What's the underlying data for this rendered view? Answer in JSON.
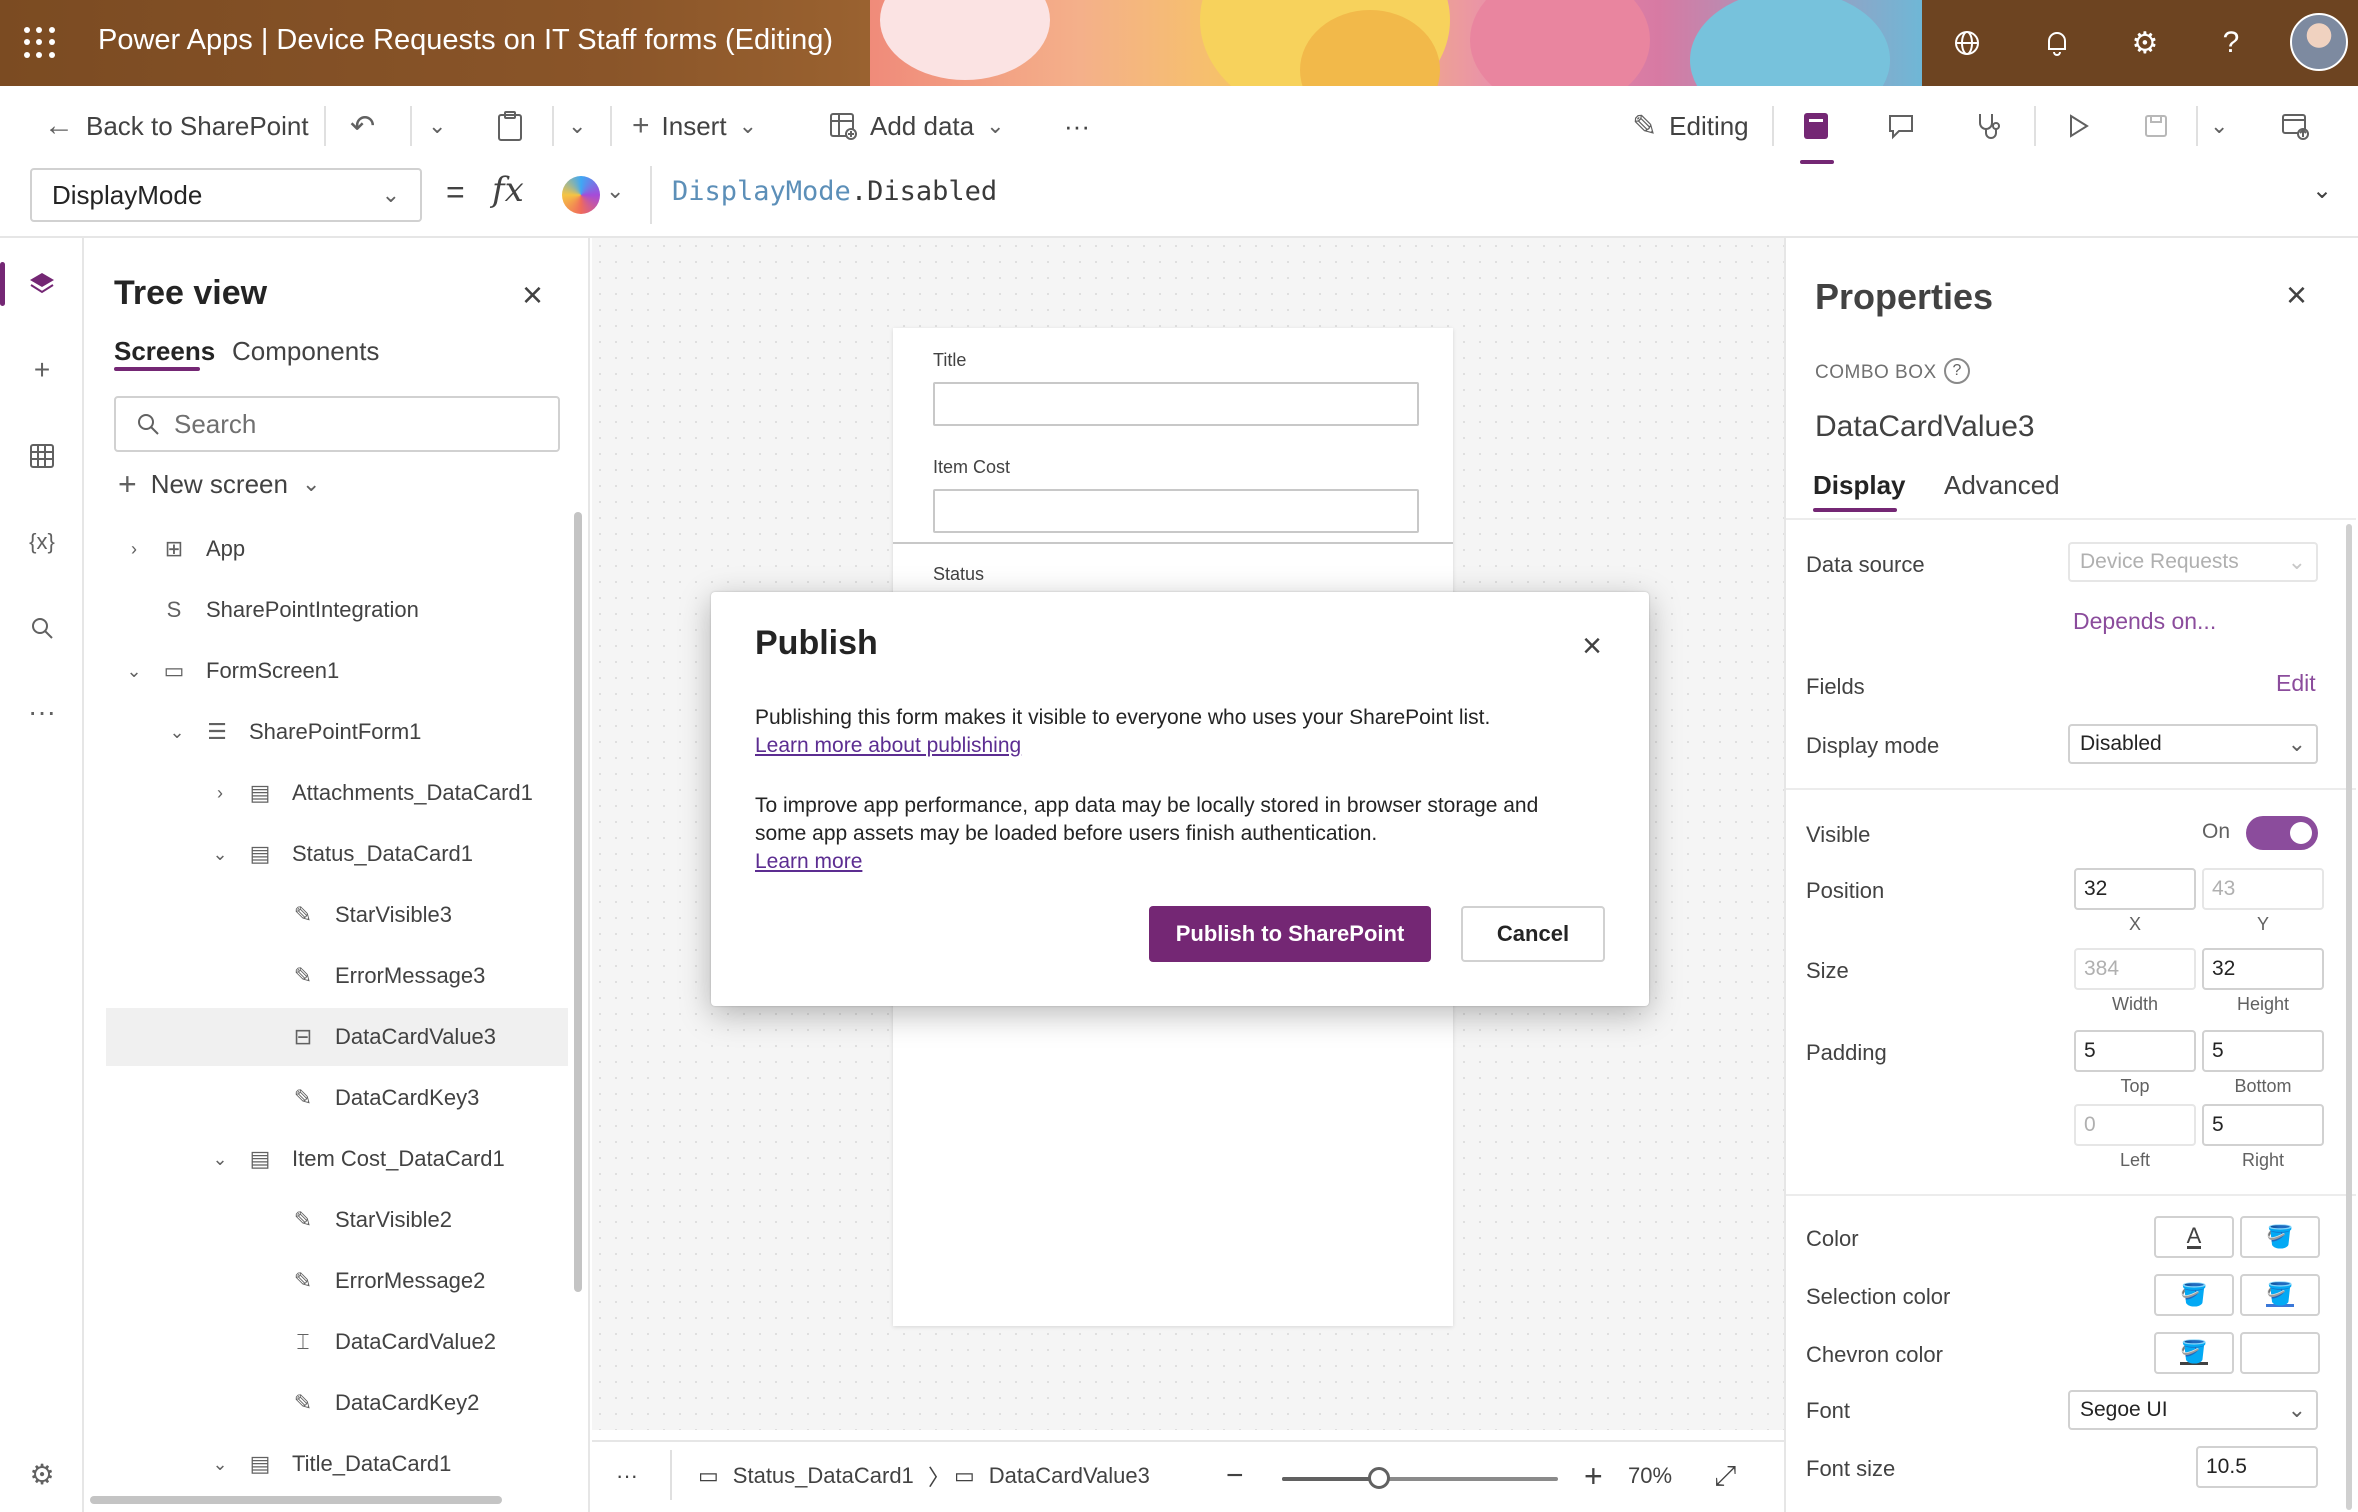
{
  "header": {
    "app_title": "Power Apps  |  Device Requests on IT Staff forms (Editing)",
    "icons": [
      "waffle-icon",
      "globe-icon",
      "bell-icon",
      "gear-icon",
      "help-icon",
      "avatar"
    ]
  },
  "toolbar": {
    "back_label": "Back to SharePoint",
    "insert_label": "Insert",
    "add_data_label": "Add data",
    "more_label": "···",
    "editing_label": "Editing"
  },
  "formula": {
    "property": "DisplayMode",
    "equals": "=",
    "fx": "fx",
    "expression_keyword": "DisplayMode",
    "expression_rest": ".Disabled"
  },
  "tree": {
    "title": "Tree view",
    "tabs": [
      "Screens",
      "Components"
    ],
    "search_placeholder": "Search",
    "new_screen": "New screen",
    "nodes": [
      {
        "label": "App",
        "twisty": ">",
        "icon": "app-icon"
      },
      {
        "label": "SharePointIntegration",
        "twisty": "",
        "icon": "sharepoint-icon"
      },
      {
        "label": "FormScreen1",
        "twisty": "v",
        "icon": "screen-icon"
      },
      {
        "label": "SharePointForm1",
        "twisty": "v",
        "icon": "form-icon"
      },
      {
        "label": "Attachments_DataCard1",
        "twisty": ">",
        "icon": "card-icon"
      },
      {
        "label": "Status_DataCard1",
        "twisty": "v",
        "icon": "card-icon"
      },
      {
        "label": "StarVisible3",
        "twisty": "",
        "icon": "label-icon"
      },
      {
        "label": "ErrorMessage3",
        "twisty": "",
        "icon": "label-icon"
      },
      {
        "label": "DataCardValue3",
        "twisty": "",
        "icon": "combobox-icon"
      },
      {
        "label": "DataCardKey3",
        "twisty": "",
        "icon": "label-icon"
      },
      {
        "label": "Item Cost_DataCard1",
        "twisty": "v",
        "icon": "card-icon"
      },
      {
        "label": "StarVisible2",
        "twisty": "",
        "icon": "label-icon"
      },
      {
        "label": "ErrorMessage2",
        "twisty": "",
        "icon": "label-icon"
      },
      {
        "label": "DataCardValue2",
        "twisty": "",
        "icon": "textinput-icon"
      },
      {
        "label": "DataCardKey2",
        "twisty": "",
        "icon": "label-icon"
      },
      {
        "label": "Title_DataCard1",
        "twisty": "v",
        "icon": "card-icon"
      }
    ],
    "selected": "DataCardValue3"
  },
  "canvas": {
    "form_labels": [
      "Title",
      "Item Cost",
      "Status"
    ],
    "breadcrumb": [
      "Status_DataCard1",
      "DataCardValue3"
    ],
    "zoom": "70%",
    "zoom_fraction": 0.35
  },
  "properties": {
    "title": "Properties",
    "type": "COMBO BOX",
    "name": "DataCardValue3",
    "tabs": [
      "Display",
      "Advanced"
    ],
    "data_source_label": "Data source",
    "data_source_value": "Device Requests",
    "depends_on": "Depends on...",
    "fields_label": "Fields",
    "fields_edit": "Edit",
    "display_mode_label": "Display mode",
    "display_mode_value": "Disabled",
    "visible_label": "Visible",
    "visible_value": "On",
    "position_label": "Position",
    "position_x": "32",
    "position_y": "43",
    "x_cap": "X",
    "y_cap": "Y",
    "size_label": "Size",
    "width": "384",
    "height": "32",
    "width_cap": "Width",
    "height_cap": "Height",
    "padding_label": "Padding",
    "padding_top": "5",
    "padding_bottom": "5",
    "padding_left": "0",
    "padding_right": "5",
    "top_cap": "Top",
    "bottom_cap": "Bottom",
    "left_cap": "Left",
    "right_cap": "Right",
    "color_label": "Color",
    "selection_color_label": "Selection color",
    "chevron_color_label": "Chevron color",
    "font_label": "Font",
    "font_value": "Segoe UI",
    "font_size_label": "Font size",
    "font_size_value": "10.5"
  },
  "dialog": {
    "title": "Publish",
    "line1": "Publishing this form makes it visible to everyone who uses your SharePoint list.",
    "link1": "Learn more about publishing",
    "line2": "To improve app performance, app data may be locally stored in browser storage and",
    "line3": "some app assets may be loaded before users finish authentication.",
    "link2": "Learn more",
    "primary": "Publish to SharePoint",
    "secondary": "Cancel"
  },
  "colors": {
    "accent": "#742774",
    "toggle": "#8b4c9c"
  }
}
